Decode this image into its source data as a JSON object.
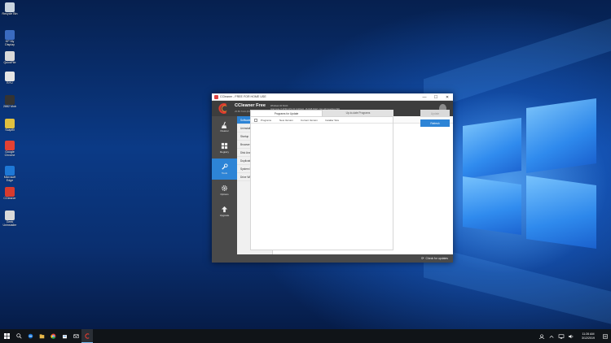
{
  "desktop": {
    "icons": [
      {
        "label": "Recycle Bin",
        "icon": "recycle-bin-icon",
        "color": "#c9d4df"
      },
      {
        "label": "HP My\nDisplay",
        "icon": "hp-display-icon",
        "color": "#3a6bc0"
      },
      {
        "label": "QuickFile",
        "icon": "file-icon",
        "color": "#d9d9d9"
      },
      {
        "label": "BYU",
        "icon": "document-icon",
        "color": "#e5e5e5"
      },
      {
        "label": "2882 Mob",
        "icon": "app-icon",
        "color": "#333333"
      },
      {
        "label": "Scapfill",
        "icon": "scapfill-icon",
        "color": "#e0c040"
      },
      {
        "label": "Google\nChrome",
        "icon": "chrome-icon",
        "color": "#e34133"
      },
      {
        "label": "Microsoft\nEdge",
        "icon": "edge-icon",
        "color": "#1e78d6"
      },
      {
        "label": "CCleaner",
        "icon": "ccleaner-icon",
        "color": "#d83b2e"
      },
      {
        "label": "Geek\nUninstaller",
        "icon": "uninstaller-icon",
        "color": "#d9d9d9"
      }
    ]
  },
  "window": {
    "title": "CCleaner - FREE FOR HOME USE",
    "controls": {
      "minimize": "—",
      "maximize": "☐",
      "close": "✕"
    },
    "app_name": "CCleaner Free",
    "version": "v5.56.7144 (64-bit)",
    "sys_line1": "Windows 10 64-bit",
    "sys_line2": "Intel Core i7-6700 CPU @ 3.40GHz, 16.0GB RAM, Intel HD Graphics 530"
  },
  "nav": [
    {
      "label": "Cleaner",
      "icon": "broom-icon",
      "active": false
    },
    {
      "label": "Registry",
      "icon": "grid-icon",
      "active": false
    },
    {
      "label": "Tools",
      "icon": "wrench-icon",
      "active": true
    },
    {
      "label": "Options",
      "icon": "gear-icon",
      "active": false
    },
    {
      "label": "Upgrade",
      "icon": "arrow-up-icon",
      "active": false
    }
  ],
  "subnav": [
    {
      "label": "Software Updater",
      "active": true
    },
    {
      "label": "Uninstall",
      "active": false
    },
    {
      "label": "Startup",
      "active": false
    },
    {
      "label": "Browser Plugins",
      "active": false
    },
    {
      "label": "Disk Analyzer",
      "active": false
    },
    {
      "label": "Duplicate Finder",
      "active": false
    },
    {
      "label": "System Restore",
      "active": false
    },
    {
      "label": "Drive Wiper",
      "active": false
    }
  ],
  "main": {
    "info_text": "Choose the programs you would like to update.",
    "tabs": [
      {
        "label": "Programs for Update",
        "active": true
      },
      {
        "label": "Up-to-date Programs",
        "active": false
      }
    ],
    "columns": [
      "Programs",
      "New Version",
      "Current Version",
      "Installer Size"
    ],
    "rows": [],
    "update_button": "Update",
    "refresh_button": "Refresh"
  },
  "footer": {
    "check_updates": "Check for updates"
  },
  "taskbar": {
    "time": "11:26 AM",
    "date": "3/12/2019"
  },
  "colors": {
    "accent": "#2d84d6",
    "header": "#3d3d3d",
    "nav_bg": "#4a4a4a"
  }
}
